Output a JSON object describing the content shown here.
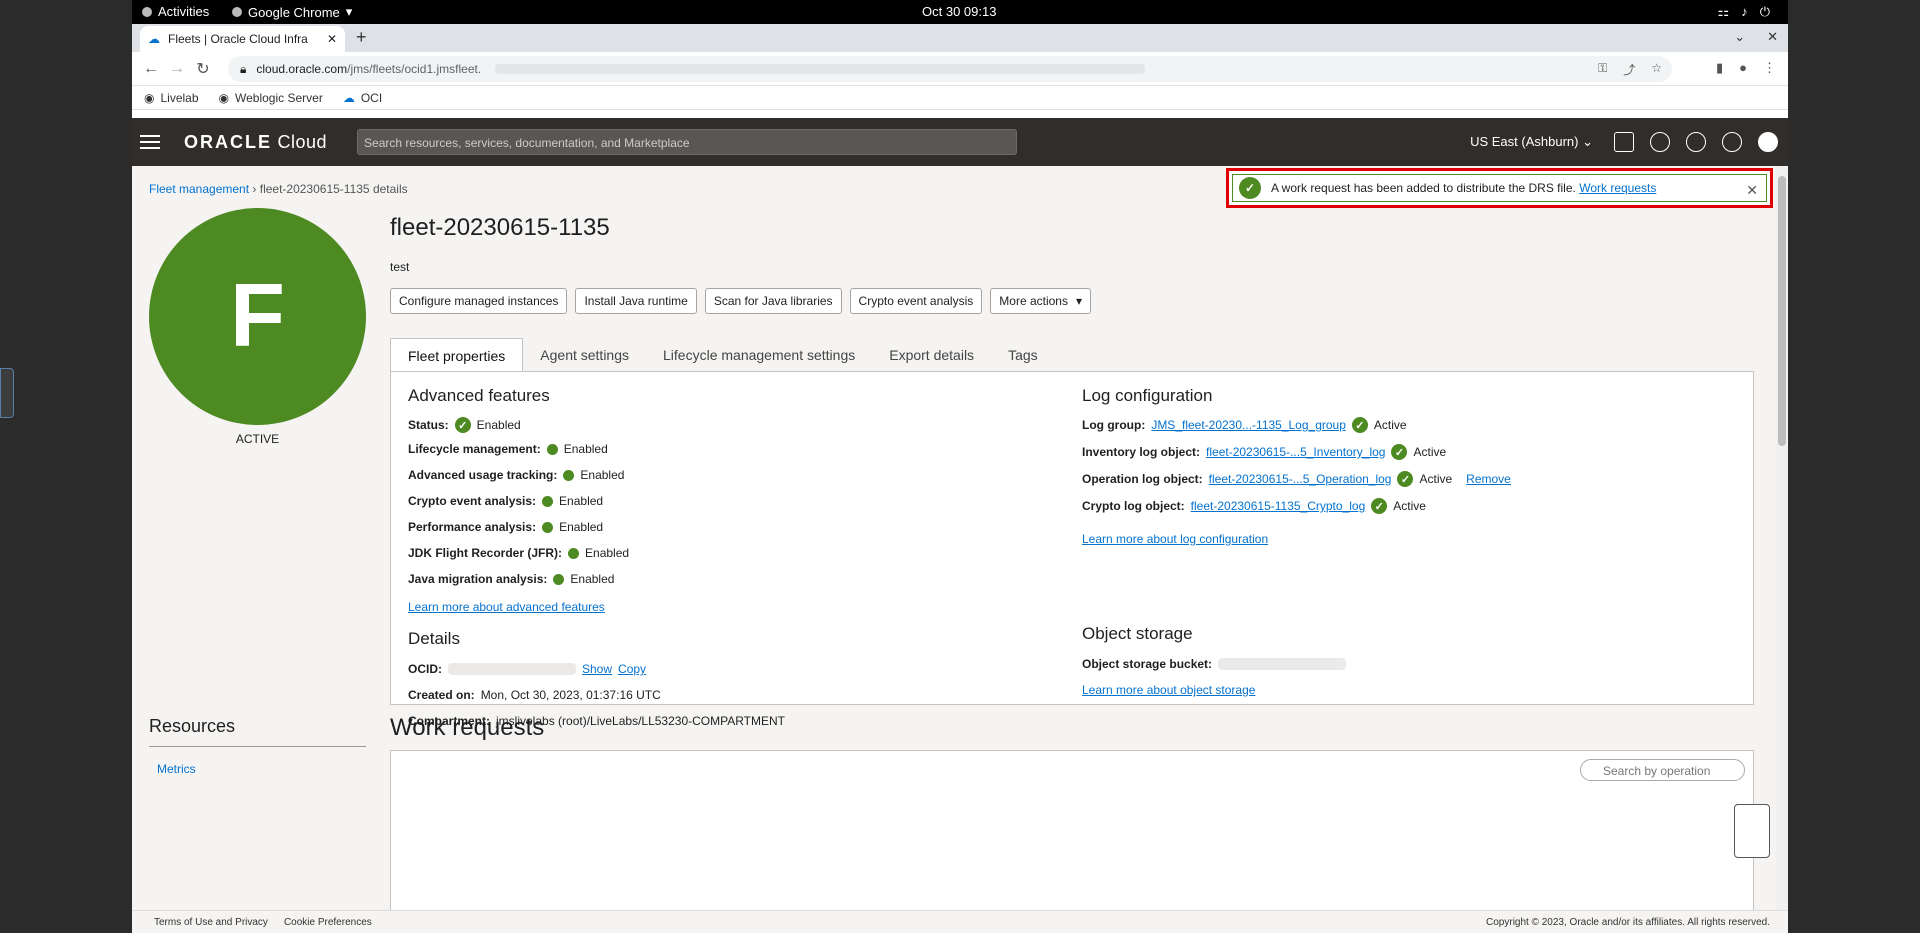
{
  "system_bar": {
    "activities": "Activities",
    "app_menu": "Google Chrome",
    "clock": "Oct 30  09:13"
  },
  "browser": {
    "tab_title": "Fleets | Oracle Cloud Infra",
    "url_host": "cloud.oracle.com",
    "url_path": "/jms/fleets/ocid1.jmsfleet.",
    "bookmarks": [
      "Livelab",
      "Weblogic Server",
      "OCI"
    ]
  },
  "oci_header": {
    "logo_bold": "ORACLE",
    "logo_rest": "Cloud",
    "search_placeholder": "Search resources, services, documentation, and Marketplace",
    "region": "US East (Ashburn)"
  },
  "breadcrumb": {
    "root": "Fleet management",
    "current": "fleet-20230615-1135 details"
  },
  "fleet": {
    "avatar_letter": "F",
    "state": "ACTIVE",
    "name": "fleet-20230615-1135",
    "description": "test"
  },
  "actions": {
    "configure": "Configure managed instances",
    "install_java": "Install Java runtime",
    "scan_libs": "Scan for Java libraries",
    "crypto": "Crypto event analysis",
    "more": "More actions"
  },
  "tabs": [
    "Fleet properties",
    "Agent settings",
    "Lifecycle management settings",
    "Export details",
    "Tags"
  ],
  "advanced_features": {
    "title": "Advanced features",
    "status_label": "Status:",
    "status_value": "Enabled",
    "items": [
      {
        "label": "Lifecycle management:",
        "value": "Enabled"
      },
      {
        "label": "Advanced usage tracking:",
        "value": "Enabled"
      },
      {
        "label": "Crypto event analysis:",
        "value": "Enabled"
      },
      {
        "label": "Performance analysis:",
        "value": "Enabled"
      },
      {
        "label": "JDK Flight Recorder (JFR):",
        "value": "Enabled"
      },
      {
        "label": "Java migration analysis:",
        "value": "Enabled"
      }
    ],
    "learn_more": "Learn more about advanced features"
  },
  "details": {
    "title": "Details",
    "ocid_label": "OCID:",
    "show": "Show",
    "copy": "Copy",
    "created_label": "Created on:",
    "created_value": "Mon, Oct 30, 2023, 01:37:16 UTC",
    "compartment_label": "Compartment:",
    "compartment_value": "jmslivelabs (root)/LiveLabs/LL53230-COMPARTMENT"
  },
  "log_config": {
    "title": "Log configuration",
    "log_group_label": "Log group:",
    "log_group_value": "JMS_fleet-20230...-1135_Log_group",
    "log_group_status": "Active",
    "inventory_label": "Inventory log object:",
    "inventory_value": "fleet-20230615-...5_Inventory_log",
    "inventory_status": "Active",
    "operation_label": "Operation log object:",
    "operation_value": "fleet-20230615-...5_Operation_log",
    "operation_status": "Active",
    "operation_remove": "Remove",
    "crypto_label": "Crypto log object:",
    "crypto_value": "fleet-20230615-1135_Crypto_log",
    "crypto_status": "Active",
    "learn_more": "Learn more about log configuration"
  },
  "object_storage": {
    "title": "Object storage",
    "bucket_label": "Object storage bucket:",
    "learn_more": "Learn more about object storage"
  },
  "toast": {
    "message": "A work request has been added to distribute the DRS file.",
    "link": "Work requests"
  },
  "resources": {
    "title": "Resources",
    "metrics": "Metrics"
  },
  "work_requests": {
    "title": "Work requests",
    "search_placeholder": "Search by operation"
  },
  "footer": {
    "terms": "Terms of Use and Privacy",
    "cookies": "Cookie Preferences",
    "copyright": "Copyright © 2023, Oracle and/or its affiliates. All rights reserved."
  },
  "colors": {
    "brand_green": "#4e8a22",
    "link_blue": "#0572ce",
    "header_bg": "#312d2a",
    "highlight_red": "#e00000"
  }
}
